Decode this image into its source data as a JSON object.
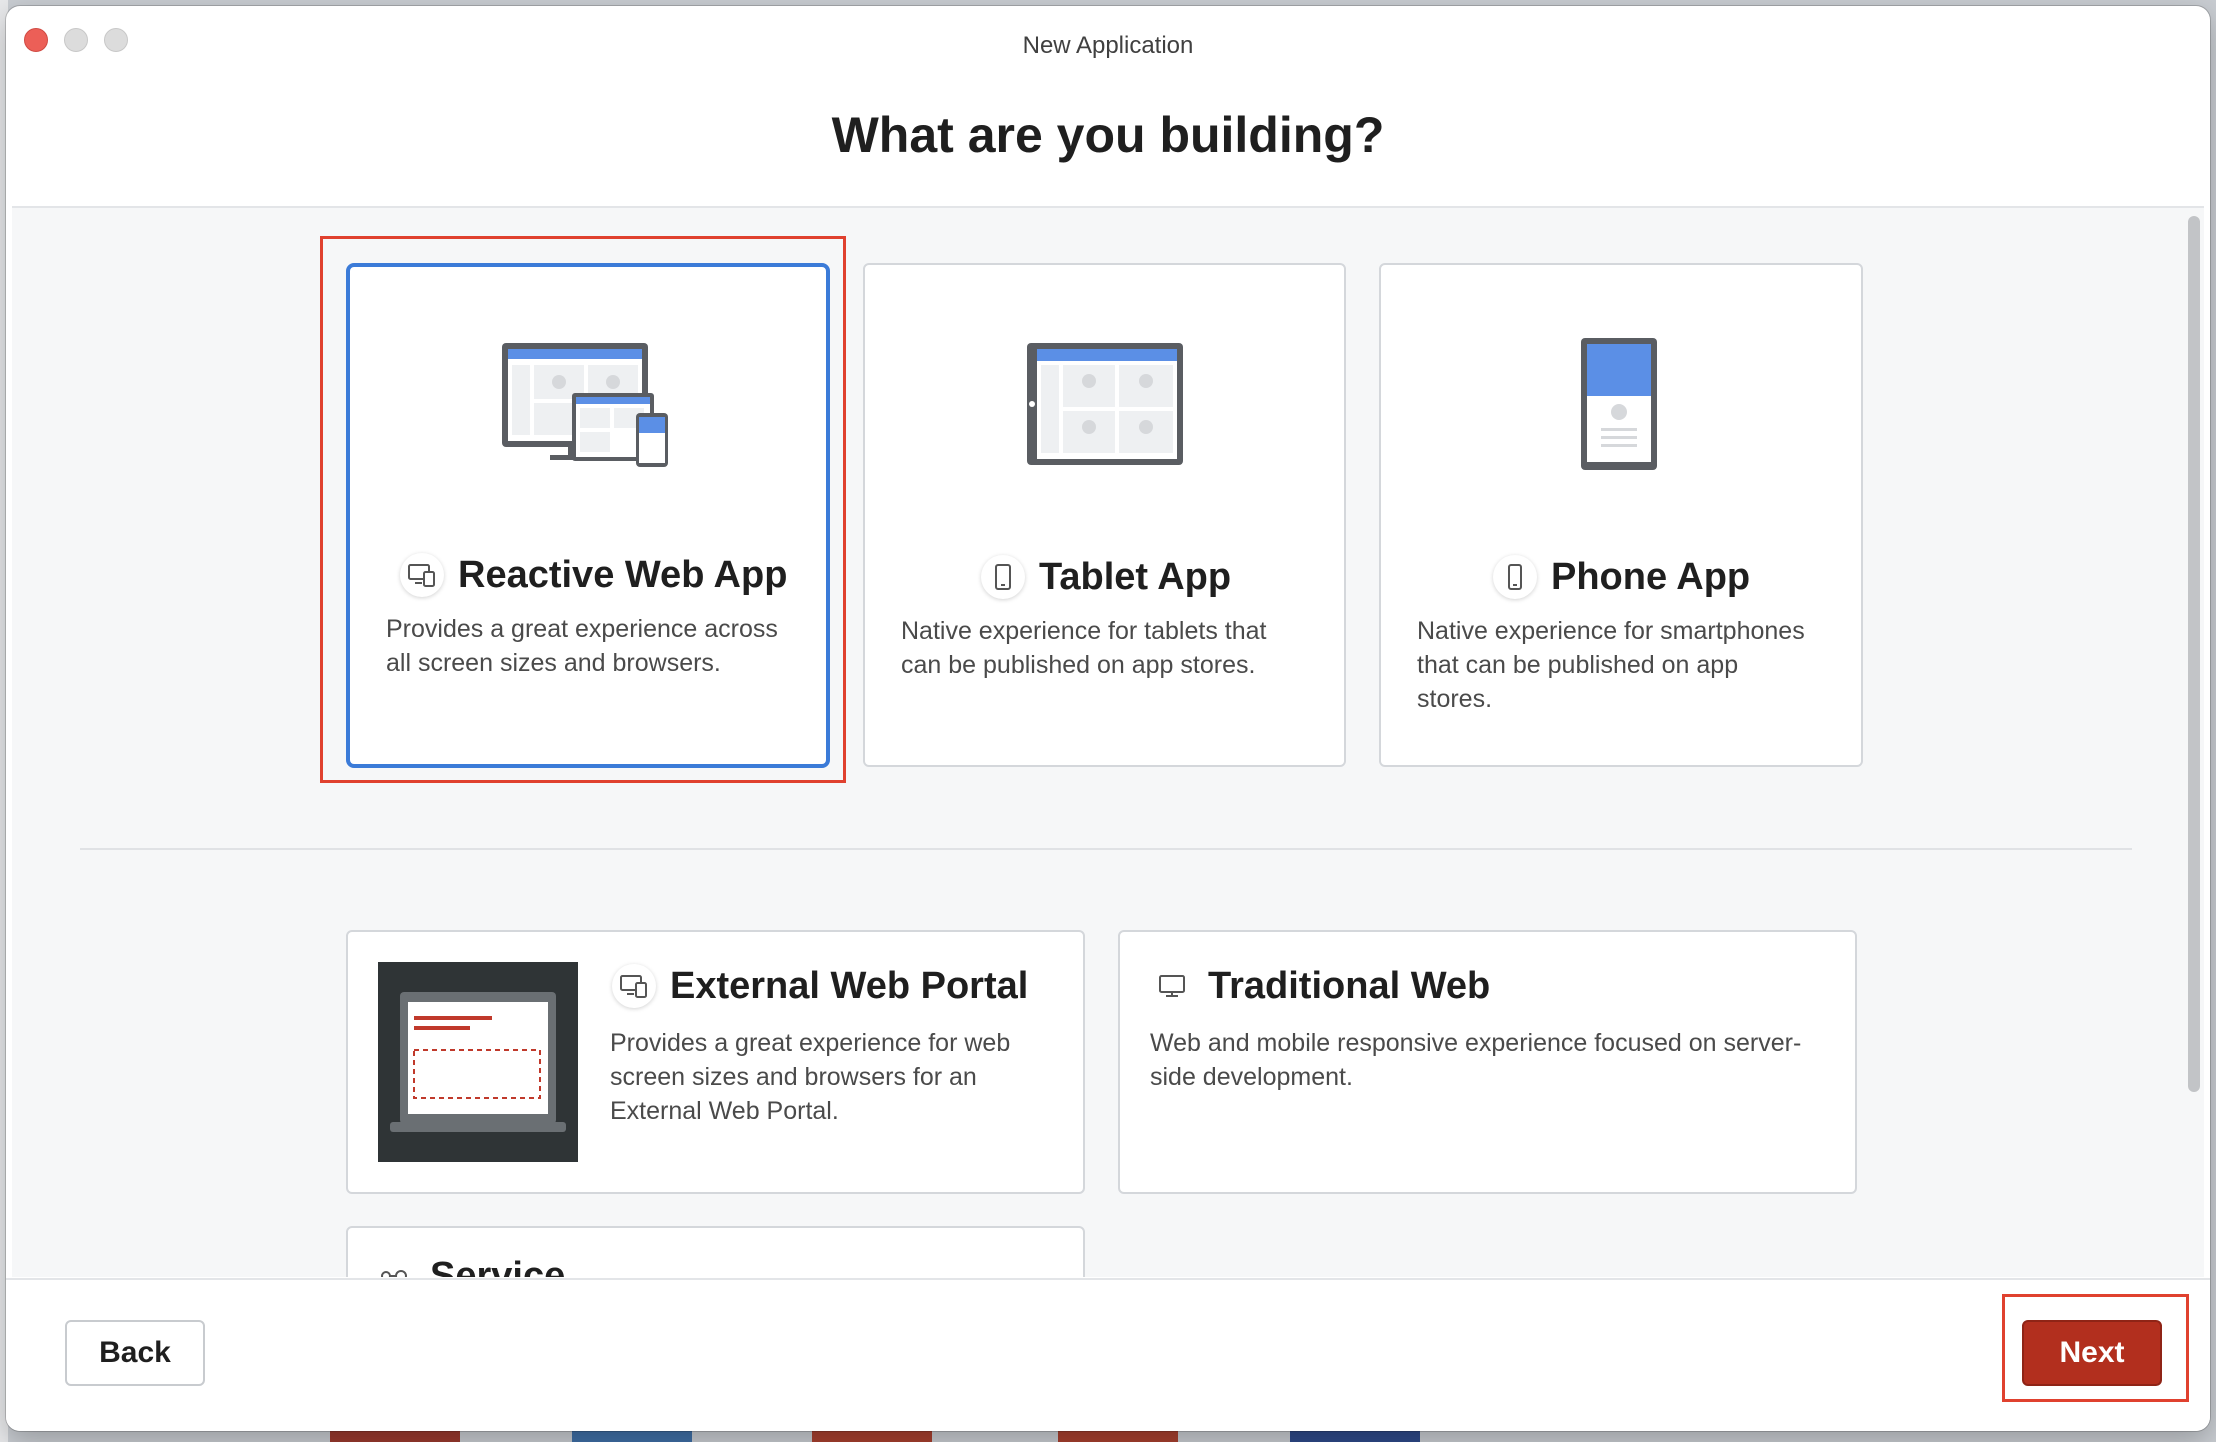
{
  "window": {
    "title": "New Application",
    "heading": "What are you building?"
  },
  "cards": {
    "reactive": {
      "title": "Reactive Web App",
      "description_line1": "Provides a great experience across",
      "description_line2": "all screen sizes and browsers.",
      "selected": true,
      "icon": "devices-icon"
    },
    "tablet": {
      "title": "Tablet App",
      "description_line1": "Native experience for tablets that",
      "description_line2": "can be published on app stores.",
      "icon": "tablet-icon"
    },
    "phone": {
      "title": "Phone App",
      "description_line1": "Native experience for smartphones",
      "description_line2": "that can be published on app",
      "description_line3": "stores.",
      "icon": "phone-icon"
    },
    "portal": {
      "title": "External Web Portal",
      "description_line1": "Provides a great experience for web",
      "description_line2": "screen sizes and browsers for an",
      "description_line3": "External Web Portal.",
      "icon": "devices-icon"
    },
    "traditional": {
      "title": "Traditional Web",
      "description_line1": "Web and mobile responsive experience focused on server-",
      "description_line2": "side development.",
      "icon": "monitor-icon"
    },
    "service": {
      "title": "Service",
      "icon": "service-icon"
    }
  },
  "footer": {
    "back_label": "Back",
    "next_label": "Next"
  },
  "colors": {
    "accent_blue": "#3b7bd8",
    "highlight_red": "#e0412f",
    "next_button": "#b22f1e"
  }
}
